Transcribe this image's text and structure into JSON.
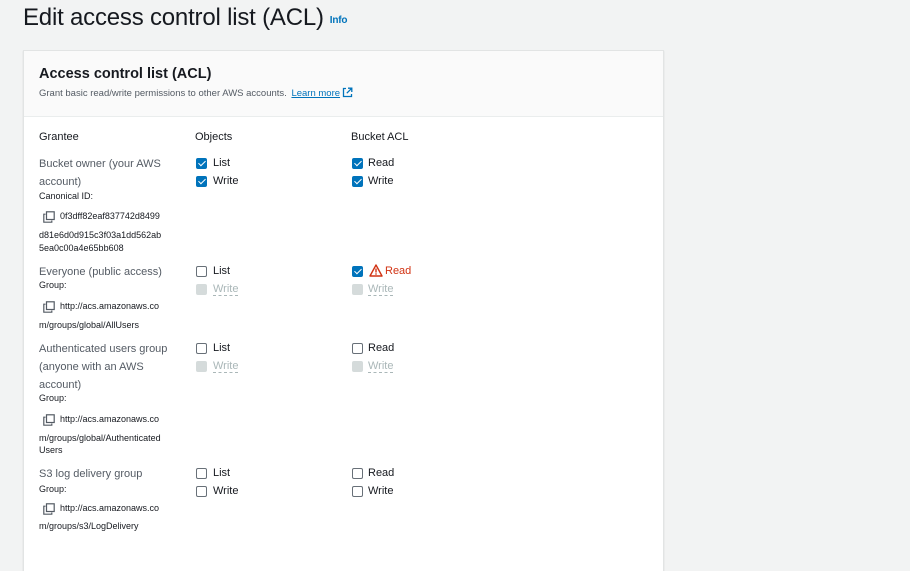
{
  "page": {
    "title": "Edit access control list (ACL)",
    "info_link": "Info"
  },
  "panel": {
    "title": "Access control list (ACL)",
    "description": "Grant basic read/write permissions to other AWS accounts.",
    "learn_more": "Learn more"
  },
  "columns": {
    "grantee": "Grantee",
    "objects": "Objects",
    "bucket_acl": "Bucket ACL"
  },
  "rows": [
    {
      "name_line1": "Bucket owner (your AWS",
      "name_line2": "account)",
      "id_label": "Canonical ID:",
      "id_line1": "0f3dff82eaf837742d8499",
      "id_line2": "d81e6d0d915c3f03a1dd562ab",
      "id_line3": "5ea0c00a4e65bb608",
      "objects_list": {
        "label": "List",
        "checked": true,
        "disabled": false
      },
      "objects_write": {
        "label": "Write",
        "checked": true,
        "disabled": false
      },
      "acl_read": {
        "label": "Read",
        "checked": true,
        "disabled": false
      },
      "acl_write": {
        "label": "Write",
        "checked": true,
        "disabled": false
      }
    },
    {
      "name_line1": "Everyone (public access)",
      "id_label": "Group:",
      "id_line1": "http://acs.amazonaws.co",
      "id_line2": "m/groups/global/AllUsers",
      "objects_list": {
        "label": "List",
        "checked": false,
        "disabled": false
      },
      "objects_write": {
        "label": "Write",
        "checked": false,
        "disabled": true
      },
      "acl_read": {
        "label": "Read",
        "checked": true,
        "disabled": false,
        "warning": true
      },
      "acl_write": {
        "label": "Write",
        "checked": false,
        "disabled": true
      }
    },
    {
      "name_line1": "Authenticated users group",
      "name_line2": "(anyone with an AWS",
      "name_line3": "account)",
      "id_label": "Group:",
      "id_line1": "http://acs.amazonaws.co",
      "id_line2": "m/groups/global/Authenticated",
      "id_line3": "Users",
      "objects_list": {
        "label": "List",
        "checked": false,
        "disabled": false
      },
      "objects_write": {
        "label": "Write",
        "checked": false,
        "disabled": true
      },
      "acl_read": {
        "label": "Read",
        "checked": false,
        "disabled": false
      },
      "acl_write": {
        "label": "Write",
        "checked": false,
        "disabled": true
      }
    },
    {
      "name_line1": "S3 log delivery group",
      "id_label": "Group:",
      "id_line1": "http://acs.amazonaws.co",
      "id_line2": "m/groups/s3/LogDelivery",
      "objects_list": {
        "label": "List",
        "checked": false,
        "disabled": false
      },
      "objects_write": {
        "label": "Write",
        "checked": false,
        "disabled": false
      },
      "acl_read": {
        "label": "Read",
        "checked": false,
        "disabled": false
      },
      "acl_write": {
        "label": "Write",
        "checked": false,
        "disabled": false
      }
    }
  ],
  "colors": {
    "accent": "#0073bb",
    "warning": "#d13212",
    "disabled": "#aab7b8"
  }
}
